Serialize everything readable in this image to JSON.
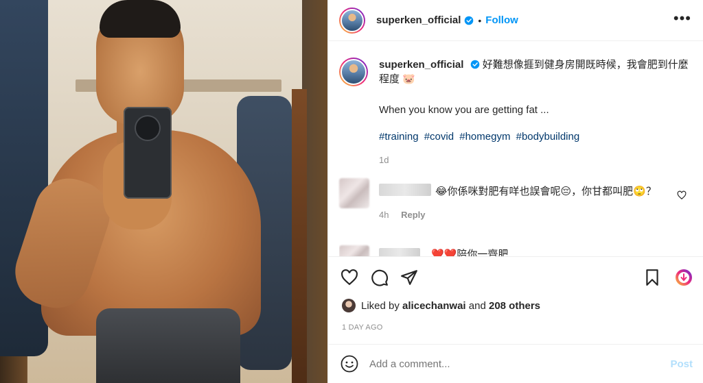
{
  "post": {
    "username": "superken_official",
    "follow_label": "Follow",
    "more_label": "•••",
    "caption_chinese": "好難想像捱到健身房開既時候，我會肥到什麼程度 🐷",
    "caption_english": "When you know you are getting fat ...",
    "hashtags": [
      "#training",
      "#covid",
      "#homegym",
      "#bodybuilding"
    ],
    "caption_age": "1d"
  },
  "comments": [
    {
      "text": "😂你係咪對肥有咩也誤會呢😔，你甘都叫肥🙄？",
      "age": "4h",
      "reply_label": "Reply"
    },
    {
      "text": "❤️❤️陪你一齊肥"
    }
  ],
  "likes": {
    "prefix": "Liked by",
    "user": "alicechanwai",
    "joiner": "and",
    "others": "208 others"
  },
  "time_ago": "1 DAY AGO",
  "add_comment": {
    "placeholder": "Add a comment...",
    "post_label": "Post"
  },
  "colors": {
    "accent": "#0095f6",
    "hashtag": "#00376b",
    "muted": "#8e8e8e",
    "post_disabled": "#b2dffc"
  }
}
